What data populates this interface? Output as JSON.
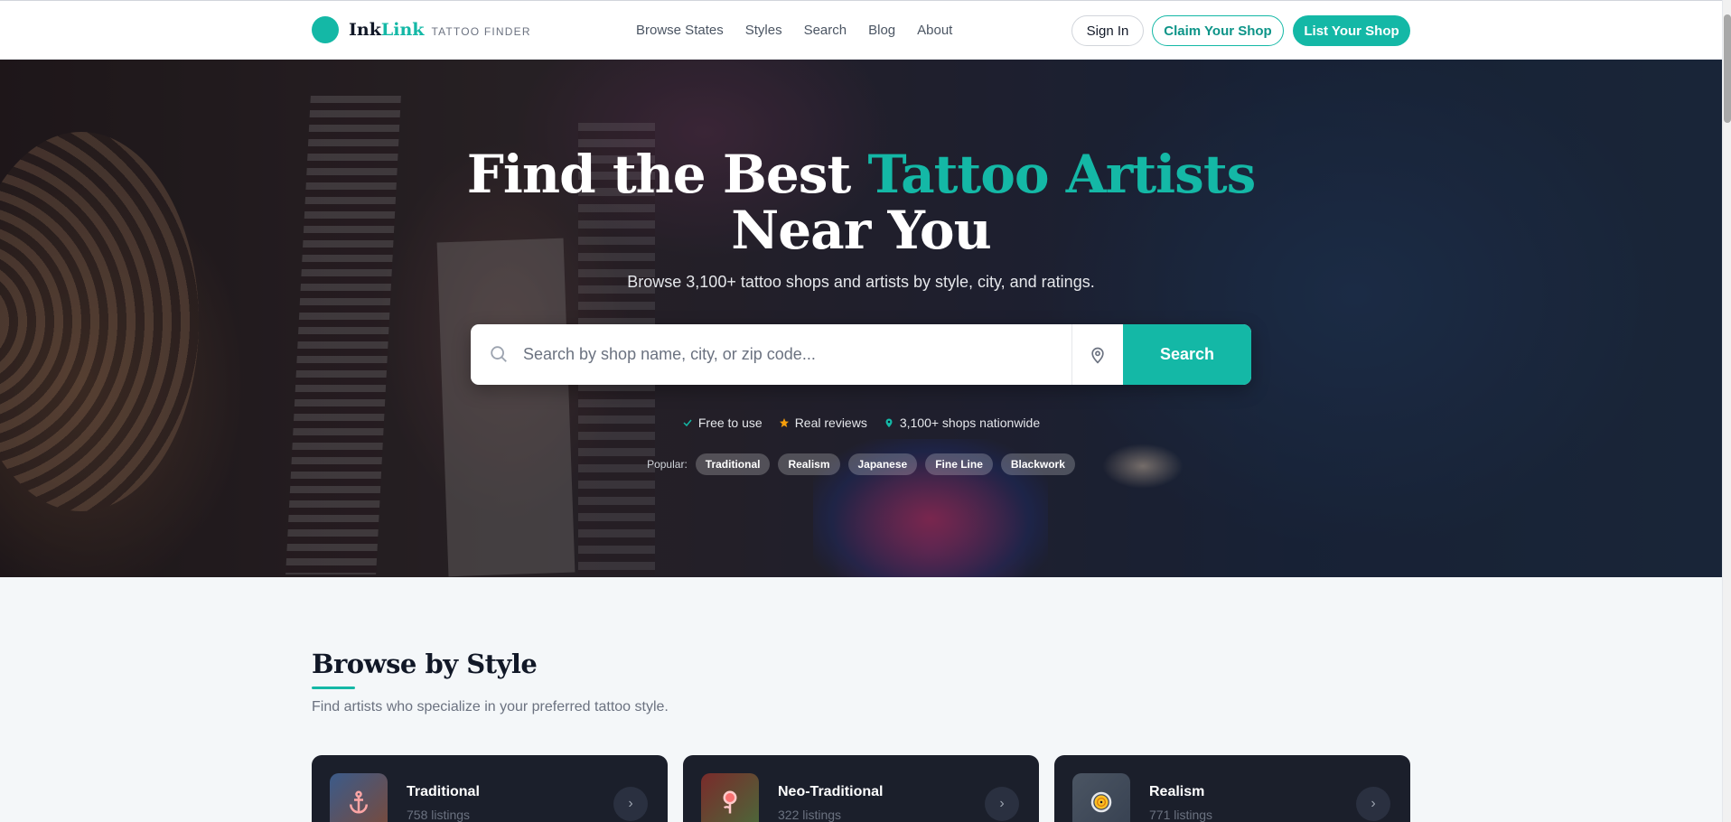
{
  "brand": {
    "ink": "Ink",
    "link": "Link",
    "tagline": "TATTOO FINDER"
  },
  "nav": [
    {
      "label": "Browse States"
    },
    {
      "label": "Styles"
    },
    {
      "label": "Search"
    },
    {
      "label": "Blog"
    },
    {
      "label": "About"
    }
  ],
  "header_buttons": {
    "sign_in": "Sign In",
    "claim": "Claim Your Shop",
    "list": "List Your Shop"
  },
  "hero": {
    "title_part1": "Find the Best ",
    "title_accent": "Tattoo Artists",
    "title_part2": " Near You",
    "subtitle": "Browse 3,100+ tattoo shops and artists by style, city, and ratings.",
    "search_placeholder": "Search by shop name, city, or zip code...",
    "search_button": "Search",
    "features": [
      {
        "icon": "check-icon",
        "label": "Free to use"
      },
      {
        "icon": "star-icon",
        "label": "Real reviews"
      },
      {
        "icon": "map-pin-icon",
        "label": "3,100+ shops nationwide"
      }
    ],
    "popular_label": "Popular:",
    "popular_tags": [
      "Traditional",
      "Realism",
      "Japanese",
      "Fine Line",
      "Blackwork"
    ]
  },
  "styles_section": {
    "title": "Browse by Style",
    "subtitle": "Find artists who specialize in your preferred tattoo style.",
    "cards": [
      {
        "name": "Traditional",
        "count": "758 listings",
        "icon": "anchor-icon"
      },
      {
        "name": "Neo-Traditional",
        "count": "322 listings",
        "icon": "rose-icon"
      },
      {
        "name": "Realism",
        "count": "771 listings",
        "icon": "eye-icon"
      }
    ]
  },
  "colors": {
    "accent": "#14b8a6",
    "dark_card": "#1b1f2b"
  }
}
